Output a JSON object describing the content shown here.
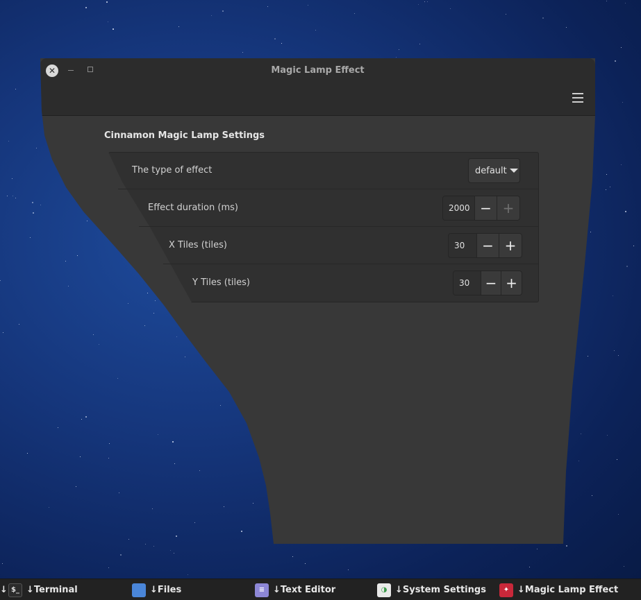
{
  "window": {
    "title": "Magic Lamp Effect",
    "close_glyph": "✕",
    "menu_icon": "hamburger-menu-icon"
  },
  "settings": {
    "section_title": "Cinnamon Magic Lamp Settings",
    "rows": [
      {
        "label": "The type of effect",
        "control": "combo",
        "value": "default"
      },
      {
        "label": "Effect duration (ms)",
        "control": "spin",
        "value": "2000"
      },
      {
        "label": "X Tiles (tiles)",
        "control": "spin",
        "value": "30"
      },
      {
        "label": "Y Tiles (tiles)",
        "control": "spin",
        "value": "30"
      }
    ],
    "minus_glyph": "−",
    "plus_glyph": "+"
  },
  "taskbar": {
    "left_glyph": "↓",
    "items": [
      {
        "label": "↓Terminal",
        "icon": "terminal-icon"
      },
      {
        "label": "↓Files",
        "icon": "folder-icon"
      },
      {
        "label": "↓Text Editor",
        "icon": "text-editor-icon"
      },
      {
        "label": "↓System Settings",
        "icon": "settings-toggle-icon"
      },
      {
        "label": "↓Magic Lamp Effect",
        "icon": "magic-lamp-icon"
      }
    ]
  },
  "colors": {
    "desktop": "#15357a",
    "window_bg": "#383838",
    "header_bg": "#2c2c2c",
    "taskbar_bg": "#222222"
  }
}
